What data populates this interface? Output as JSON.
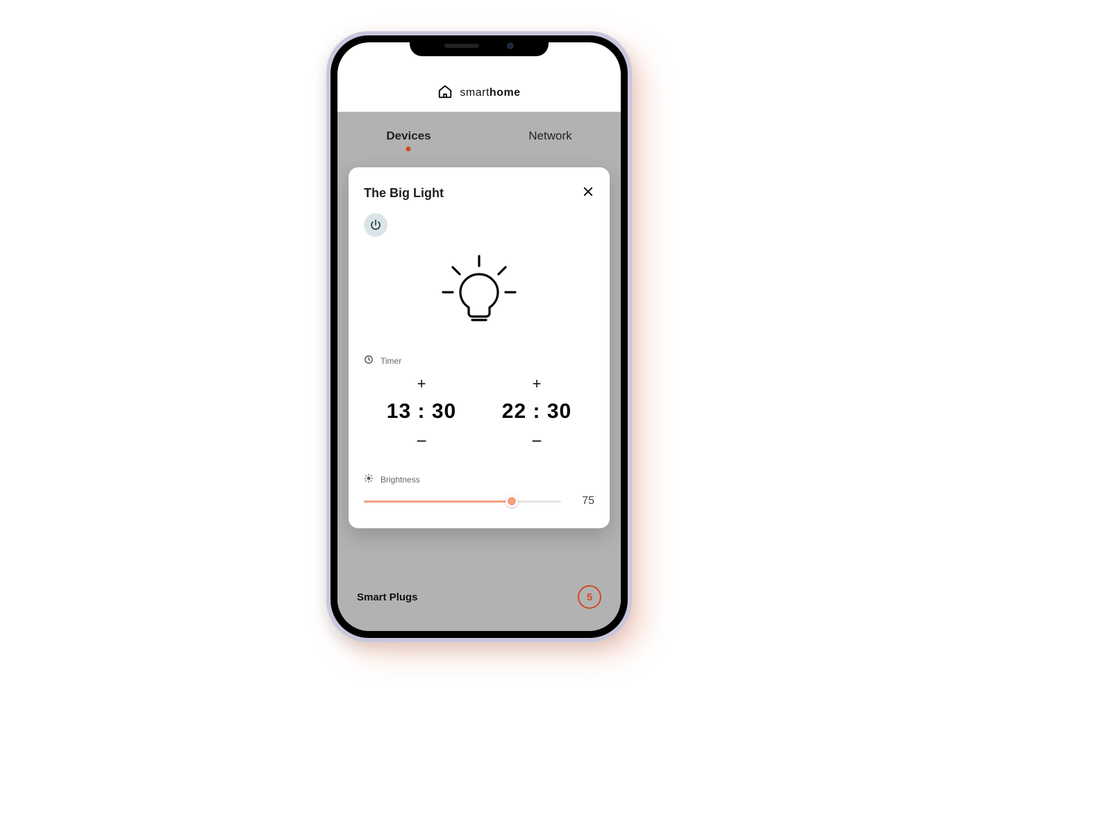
{
  "header": {
    "brand_light": "smart",
    "brand_bold": "home"
  },
  "tabs": {
    "active": "Devices",
    "inactive": "Network"
  },
  "modal": {
    "title": "The Big Light",
    "timer_label": "Timer",
    "brightness_label": "Brightness",
    "time_start": "13 : 30",
    "time_end": "22 : 30",
    "brightness_value": "75",
    "brightness_percent": 75
  },
  "bottom": {
    "label": "Smart Plugs",
    "count": "5"
  },
  "colors": {
    "accent": "#f2a17e",
    "accent_ring": "#cf4a1f"
  }
}
